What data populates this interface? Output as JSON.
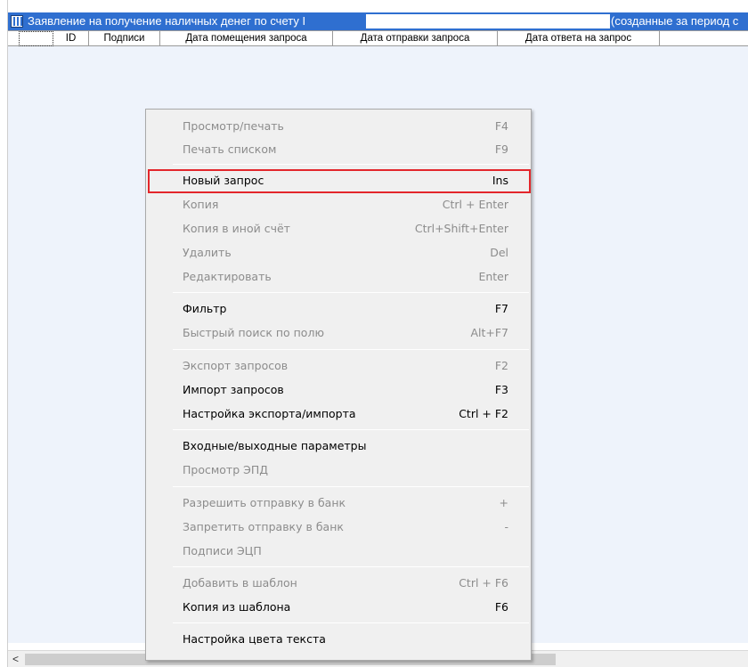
{
  "window": {
    "title_left": "Заявление на получение наличных денег по счету I",
    "title_right": "(созданные за период с"
  },
  "grid": {
    "columns": [
      "ID",
      "Подписи",
      "Дата помещения запроса",
      "Дата отправки запроса",
      "Дата ответа на запрос"
    ]
  },
  "scrollbar": {
    "left_arrow": "<"
  },
  "menu": {
    "items": [
      {
        "label": "Просмотр/печать",
        "key": "F4",
        "enabled": false
      },
      {
        "label": "Печать списком",
        "key": "F9",
        "enabled": false
      },
      {
        "label": "Новый запрос",
        "key": "Ins",
        "enabled": true,
        "highlighted": true
      },
      {
        "label": "Копия",
        "key": "Ctrl + Enter",
        "enabled": false
      },
      {
        "label": "Копия в иной счёт",
        "key": "Ctrl+Shift+Enter",
        "enabled": false
      },
      {
        "label": "Удалить",
        "key": "Del",
        "enabled": false
      },
      {
        "label": "Редактировать",
        "key": "Enter",
        "enabled": false
      },
      {
        "label": "Фильтр",
        "key": "F7",
        "enabled": true
      },
      {
        "label": "Быстрый поиск по полю",
        "key": "Alt+F7",
        "enabled": false
      },
      {
        "label": "Экспорт запросов",
        "key": "F2",
        "enabled": false
      },
      {
        "label": "Импорт запросов",
        "key": "F3",
        "enabled": true
      },
      {
        "label": "Настройка экспорта/импорта",
        "key": "Ctrl + F2",
        "enabled": true
      },
      {
        "label": "Входные/выходные параметры",
        "key": "",
        "enabled": true
      },
      {
        "label": "Просмотр ЭПД",
        "key": "",
        "enabled": false
      },
      {
        "label": "Разрешить отправку в банк",
        "key": "+",
        "enabled": false
      },
      {
        "label": "Запретить отправку в банк",
        "key": "-",
        "enabled": false
      },
      {
        "label": "Подписи ЭЦП",
        "key": "",
        "enabled": false
      },
      {
        "label": "Добавить в шаблон",
        "key": "Ctrl + F6",
        "enabled": false
      },
      {
        "label": "Копия из шаблона",
        "key": "F6",
        "enabled": true
      },
      {
        "label": "Настройка цвета текста",
        "key": "",
        "enabled": true
      }
    ]
  },
  "colors": {
    "titlebar": "#2f6fd0",
    "highlight_border": "#e3262b",
    "disabled_text": "#8c8c8c",
    "menu_background": "#f0f0f0",
    "grid_background": "#eef3fb"
  }
}
